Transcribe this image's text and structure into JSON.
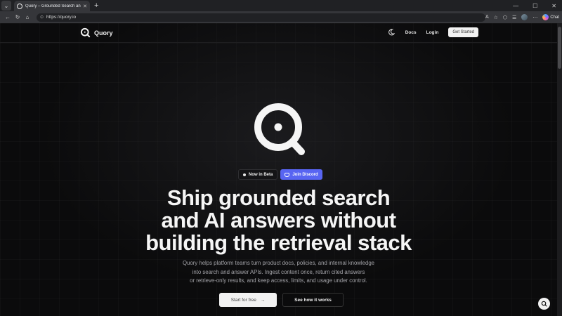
{
  "browser": {
    "tab_title": "Quory – Grounded Search and AI A",
    "tab_close": "✕",
    "new_tab": "+",
    "address": "https://quory.io",
    "copilot_label": "Chat"
  },
  "site": {
    "brand": "Quory",
    "nav": {
      "docs": "Docs",
      "login": "Login",
      "get_started": "Get Started"
    },
    "badges": {
      "beta": "Now in Beta",
      "discord": "Join Discord"
    },
    "headline": [
      "Ship grounded search",
      "and AI answers without",
      "building the retrieval stack"
    ],
    "subtext": [
      "Quory helps platform teams turn product docs, policies, and internal knowledge",
      "into search and answer APIs. Ingest content once, return cited answers",
      "or retrieve-only results, and keep access, limits, and usage under control."
    ],
    "cta": {
      "primary": "Start for free",
      "primary_arrow": "→",
      "secondary": "See how it works"
    }
  },
  "colors": {
    "background": "#0b0b0c",
    "discord": "#5865f2",
    "text": "#f5f5f5",
    "muted": "#a3a3a8"
  }
}
